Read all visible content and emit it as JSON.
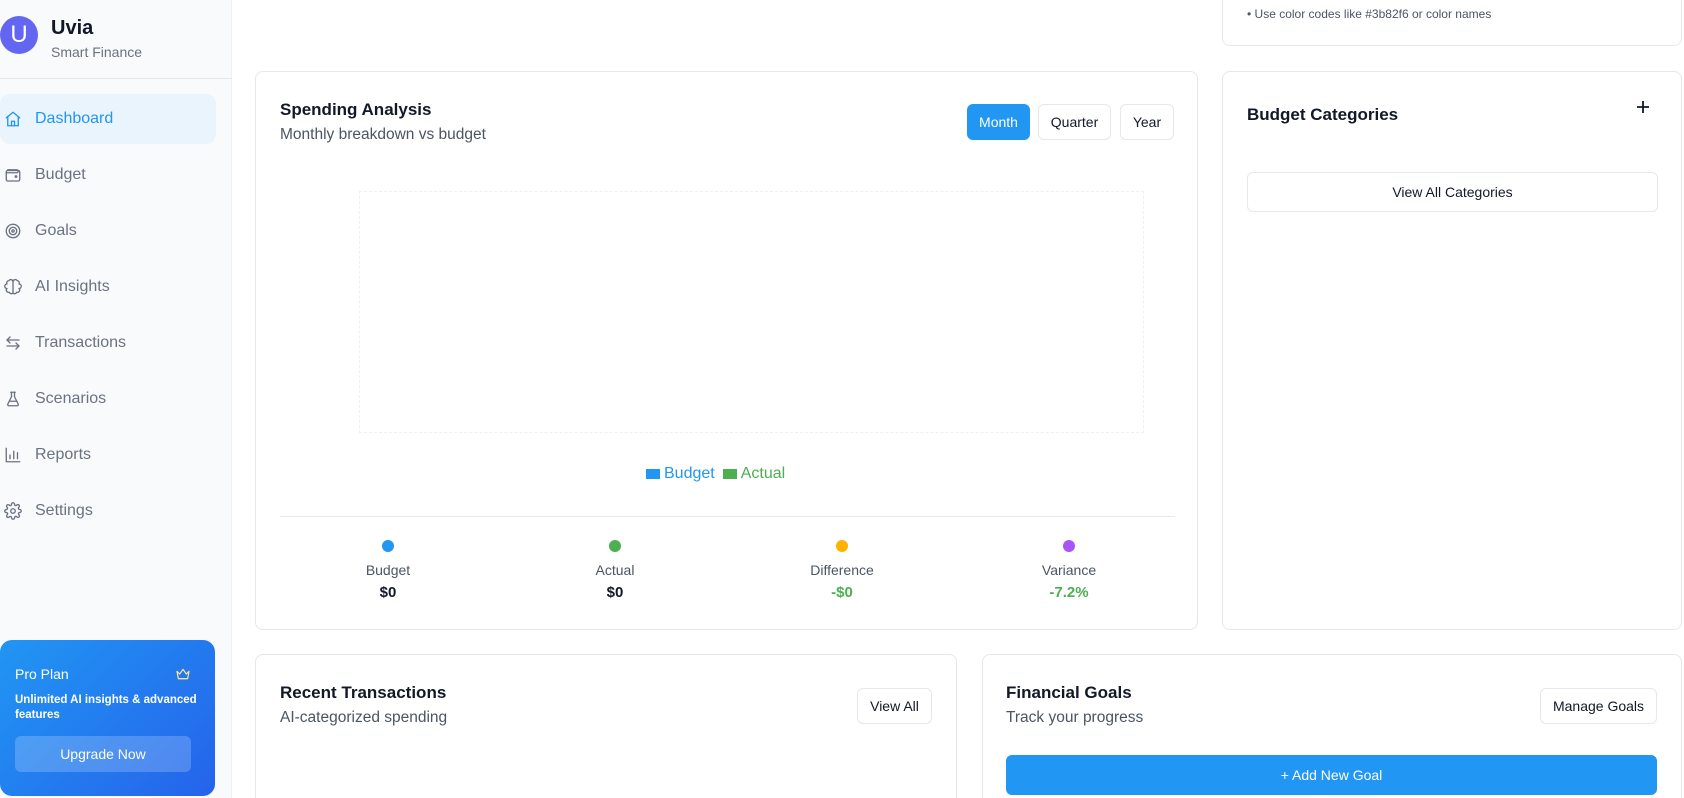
{
  "brand": {
    "initial": "U",
    "name": "Uvia",
    "subtitle": "Smart Finance"
  },
  "nav": [
    {
      "label": "Dashboard",
      "icon": "home-icon",
      "active": true
    },
    {
      "label": "Budget",
      "icon": "wallet-icon"
    },
    {
      "label": "Goals",
      "icon": "target-icon"
    },
    {
      "label": "AI Insights",
      "icon": "brain-icon"
    },
    {
      "label": "Transactions",
      "icon": "arrows-icon"
    },
    {
      "label": "Scenarios",
      "icon": "flask-icon"
    },
    {
      "label": "Reports",
      "icon": "bar-chart-icon"
    },
    {
      "label": "Settings",
      "icon": "gear-icon"
    }
  ],
  "pro_plan": {
    "title": "Pro Plan",
    "icon": "crown-icon",
    "description": "Unlimited AI insights & advanced features",
    "button": "Upgrade Now"
  },
  "top_note": {
    "text": "• Use color codes like #3b82f6 or color names"
  },
  "spending": {
    "title": "Spending Analysis",
    "subtitle": "Monthly breakdown vs budget",
    "periods": [
      "Month",
      "Quarter",
      "Year"
    ],
    "selected_period": "Month",
    "legend": [
      {
        "label": "Budget",
        "color": "#2196f3"
      },
      {
        "label": "Actual",
        "color": "#4caf50"
      }
    ],
    "stats": [
      {
        "label": "Budget",
        "value": "$0",
        "dot_color": "#2196f3",
        "value_color": "#111827"
      },
      {
        "label": "Actual",
        "value": "$0",
        "dot_color": "#4caf50",
        "value_color": "#111827"
      },
      {
        "label": "Difference",
        "value": "-$0",
        "dot_color": "#ffb300",
        "value_color": "#4caf50"
      },
      {
        "label": "Variance",
        "value": "-7.2%",
        "dot_color": "#a855f7",
        "value_color": "#4caf50"
      }
    ]
  },
  "budget_categories": {
    "title": "Budget Categories",
    "add_icon": "plus-icon",
    "view_all": "View All Categories"
  },
  "recent_transactions": {
    "title": "Recent Transactions",
    "subtitle": "AI-categorized spending",
    "button": "View All"
  },
  "financial_goals": {
    "title": "Financial Goals",
    "subtitle": "Track your progress",
    "manage_button": "Manage Goals",
    "add_button": "+ Add New Goal"
  },
  "colors": {
    "accent": "#2196f3",
    "success": "#4caf50",
    "active_nav_bg": "#eaf4fd"
  }
}
